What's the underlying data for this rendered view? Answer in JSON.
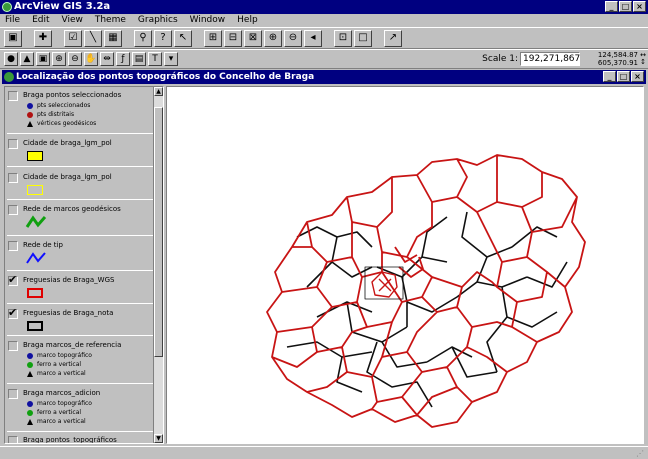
{
  "app": {
    "title": "ArcView GIS 3.2a"
  },
  "menu": [
    "File",
    "Edit",
    "View",
    "Theme",
    "Graphics",
    "Window",
    "Help"
  ],
  "toolbar1": {
    "icons": [
      "save-icon",
      "add-theme-icon",
      "theme-properties-icon",
      "edit-legend-icon",
      "open-table-icon",
      "find-icon",
      "query-icon",
      "locate-icon",
      "zoom-full-icon",
      "zoom-active-icon",
      "zoom-selected-icon",
      "zoom-in-icon",
      "zoom-out-icon",
      "zoom-previous-icon",
      "select-feature-icon",
      "clear-select-icon",
      "help-icon"
    ]
  },
  "toolbar2": {
    "icons": [
      "identify-icon",
      "pointer-icon",
      "vertex-edit-icon",
      "zoom-in-tool-icon",
      "zoom-out-tool-icon",
      "pan-icon",
      "measure-icon",
      "hotlink-icon",
      "label-icon",
      "text-icon",
      "draw-icon"
    ],
    "glyphs": {
      "identify": "●",
      "pointer": "▲",
      "vertex": "▣",
      "zoomin": "⊕",
      "zoomout": "⊖",
      "pan": "✋",
      "measure": "⇹",
      "hotlink": "ƒ",
      "label": "▤",
      "text": "T",
      "draw": "▾"
    },
    "scale_label": "Scale 1:",
    "scale_value": "192,271,867",
    "coord_x": "124,584.87",
    "coord_y": "605,370.91"
  },
  "view": {
    "title": "Localização dos pontos topográficos do Concelho de Braga"
  },
  "legend": [
    {
      "name": "Braga pontos seleccionados",
      "checked": false,
      "items": [
        {
          "sym": "dot",
          "color": "#1010a0",
          "label": "pts seleccionados"
        },
        {
          "sym": "dot",
          "color": "#b01010",
          "label": "pts distritais"
        },
        {
          "sym": "tri",
          "color": "#000000",
          "label": "vértices geodésicos"
        }
      ]
    },
    {
      "name": "Cidade de braga_lgm_pol",
      "checked": false,
      "rect": {
        "fill": "#ffff00",
        "stroke": "#000000"
      }
    },
    {
      "name": "Cidade de braga_lgm_pol",
      "checked": false,
      "rect": {
        "fill": "#c0c0c0",
        "stroke": "#ffff00"
      }
    },
    {
      "name": "Rede de marcos geodésicos",
      "checked": false,
      "line": {
        "color": "#10a010"
      }
    },
    {
      "name": "Rede de tip",
      "checked": false,
      "line": {
        "color": "#1010ff"
      }
    },
    {
      "name": "Freguesias de Braga_WGS",
      "checked": true,
      "rect": {
        "fill": "#c0c0c0",
        "stroke": "#e00000"
      }
    },
    {
      "name": "Freguesias de Braga_nota",
      "checked": true,
      "rect": {
        "fill": "#c0c0c0",
        "stroke": "#000000"
      }
    },
    {
      "name": "Braga marcos_de referencia",
      "checked": false,
      "items": [
        {
          "sym": "dot",
          "color": "#1010a0",
          "label": "marco topográfico"
        },
        {
          "sym": "dot",
          "color": "#10a010",
          "label": "ferro a vertical"
        },
        {
          "sym": "tri",
          "color": "#000000",
          "label": "marco a vertical"
        }
      ]
    },
    {
      "name": "Braga marcos_adicion",
      "checked": false,
      "items": [
        {
          "sym": "dot",
          "color": "#1010a0",
          "label": "marco topográfico"
        },
        {
          "sym": "dot",
          "color": "#10a010",
          "label": "ferro a vertical"
        },
        {
          "sym": "tri",
          "color": "#000000",
          "label": "marco a vertical"
        }
      ]
    },
    {
      "name": "Braga pontos_topográficos",
      "checked": false
    }
  ],
  "colors": {
    "titlebar": "#000080",
    "map_red": "#c81414",
    "map_black": "#101010"
  }
}
